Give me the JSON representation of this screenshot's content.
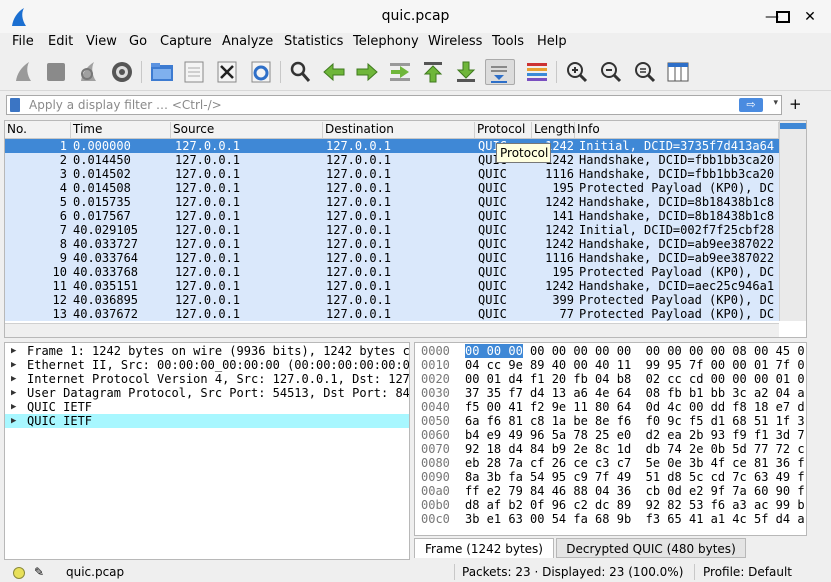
{
  "window": {
    "title": "quic.pcap",
    "min": "—",
    "max": "☐",
    "close": "✕"
  },
  "menu": [
    "File",
    "Edit",
    "View",
    "Go",
    "Capture",
    "Analyze",
    "Statistics",
    "Telephony",
    "Wireless",
    "Tools",
    "Help"
  ],
  "toolbar_icons": [
    "start-capture-icon",
    "stop-capture-icon",
    "restart-capture-icon",
    "capture-options-icon",
    "open-file-icon",
    "save-file-icon",
    "close-file-icon",
    "reload-file-icon",
    "find-packet-icon",
    "go-back-icon",
    "go-forward-icon",
    "go-to-packet-icon",
    "first-packet-icon",
    "last-packet-icon",
    "autoscroll-icon",
    "colorize-icon",
    "zoom-in-icon",
    "zoom-out-icon",
    "normal-size-icon",
    "resize-columns-icon"
  ],
  "filter": {
    "placeholder": "Apply a display filter … <Ctrl-/>",
    "apply": "⇨",
    "dropdown": "▾",
    "add": "+"
  },
  "columns": [
    "No.",
    "Time",
    "Source",
    "Destination",
    "Protocol",
    "Length",
    "Info"
  ],
  "packets": [
    {
      "no": "1",
      "time": "0.000000",
      "src": "127.0.0.1",
      "dst": "127.0.0.1",
      "proto": "QUIC",
      "len": "1242",
      "info": "Initial, DCID=3735f7d413a64"
    },
    {
      "no": "2",
      "time": "0.014450",
      "src": "127.0.0.1",
      "dst": "127.0.0.1",
      "proto": "QUIC",
      "len": "1242",
      "info": "Handshake, DCID=fbb1bb3ca20"
    },
    {
      "no": "3",
      "time": "0.014502",
      "src": "127.0.0.1",
      "dst": "127.0.0.1",
      "proto": "QUIC",
      "len": "1116",
      "info": "Handshake, DCID=fbb1bb3ca20"
    },
    {
      "no": "4",
      "time": "0.014508",
      "src": "127.0.0.1",
      "dst": "127.0.0.1",
      "proto": "QUIC",
      "len": "195",
      "info": "Protected Payload (KP0), DC"
    },
    {
      "no": "5",
      "time": "0.015735",
      "src": "127.0.0.1",
      "dst": "127.0.0.1",
      "proto": "QUIC",
      "len": "1242",
      "info": "Handshake, DCID=8b18438b1c8"
    },
    {
      "no": "6",
      "time": "0.017567",
      "src": "127.0.0.1",
      "dst": "127.0.0.1",
      "proto": "QUIC",
      "len": "141",
      "info": "Handshake, DCID=8b18438b1c8"
    },
    {
      "no": "7",
      "time": "40.029105",
      "src": "127.0.0.1",
      "dst": "127.0.0.1",
      "proto": "QUIC",
      "len": "1242",
      "info": "Initial, DCID=002f7f25cbf28"
    },
    {
      "no": "8",
      "time": "40.033727",
      "src": "127.0.0.1",
      "dst": "127.0.0.1",
      "proto": "QUIC",
      "len": "1242",
      "info": "Handshake, DCID=ab9ee387022"
    },
    {
      "no": "9",
      "time": "40.033764",
      "src": "127.0.0.1",
      "dst": "127.0.0.1",
      "proto": "QUIC",
      "len": "1116",
      "info": "Handshake, DCID=ab9ee387022"
    },
    {
      "no": "10",
      "time": "40.033768",
      "src": "127.0.0.1",
      "dst": "127.0.0.1",
      "proto": "QUIC",
      "len": "195",
      "info": "Protected Payload (KP0), DC"
    },
    {
      "no": "11",
      "time": "40.035151",
      "src": "127.0.0.1",
      "dst": "127.0.0.1",
      "proto": "QUIC",
      "len": "1242",
      "info": "Handshake, DCID=aec25c946a1"
    },
    {
      "no": "12",
      "time": "40.036895",
      "src": "127.0.0.1",
      "dst": "127.0.0.1",
      "proto": "QUIC",
      "len": "399",
      "info": "Protected Payload (KP0), DC"
    },
    {
      "no": "13",
      "time": "40.037672",
      "src": "127.0.0.1",
      "dst": "127.0.0.1",
      "proto": "QUIC",
      "len": "77",
      "info": "Protected Payload (KP0), DC"
    }
  ],
  "tooltip": "Protocol",
  "details": [
    "Frame 1: 1242 bytes on wire (9936 bits), 1242 bytes c",
    "Ethernet II, Src: 00:00:00_00:00:00 (00:00:00:00:00:0",
    "Internet Protocol Version 4, Src: 127.0.0.1, Dst: 127",
    "User Datagram Protocol, Src Port: 54513, Dst Port: 84",
    "QUIC IETF",
    "QUIC IETF"
  ],
  "hex": [
    {
      "off": "0000",
      "first": "00 00 00",
      "rest": " 00 00 00 00 00  00 00 00 00 08 00 45 0"
    },
    {
      "off": "0010",
      "first": "",
      "rest": "04 cc 9e 89 40 00 40 11  99 95 7f 00 00 01 7f 0"
    },
    {
      "off": "0020",
      "first": "",
      "rest": "00 01 d4 f1 20 fb 04 b8  02 cc cd 00 00 00 01 0"
    },
    {
      "off": "0030",
      "first": "",
      "rest": "37 35 f7 d4 13 a6 4e 64  08 fb b1 bb 3c a2 04 a"
    },
    {
      "off": "0040",
      "first": "",
      "rest": "f5 00 41 f2 9e 11 80 64  0d 4c 00 dd f8 18 e7 d"
    },
    {
      "off": "0050",
      "first": "",
      "rest": "6a f6 81 c8 1a be 8e f6  f0 9c f5 d1 68 51 1f 3"
    },
    {
      "off": "0060",
      "first": "",
      "rest": "b4 e9 49 96 5a 78 25 e0  d2 ea 2b 93 f9 f1 3d 7"
    },
    {
      "off": "0070",
      "first": "",
      "rest": "92 18 d4 84 b9 2e 8c 1d  db 74 2e 0b 5d 77 72 c"
    },
    {
      "off": "0080",
      "first": "",
      "rest": "eb 28 7a cf 26 ce c3 c7  5e 0e 3b 4f ce 81 36 f"
    },
    {
      "off": "0090",
      "first": "",
      "rest": "8a 3b fa 54 95 c9 7f 49  51 d8 5c cd 7c 63 49 f"
    },
    {
      "off": "00a0",
      "first": "",
      "rest": "ff e2 79 84 46 88 04 36  cb 0d e2 9f 7a 60 90 f"
    },
    {
      "off": "00b0",
      "first": "",
      "rest": "d8 af b2 0f 96 c2 dc 89  92 82 53 f6 a3 ac 99 b"
    },
    {
      "off": "00c0",
      "first": "",
      "rest": "3b e1 63 00 54 fa 68 9b  f3 65 41 a1 4c 5f d4 a"
    }
  ],
  "tabs": [
    "Frame (1242 bytes)",
    "Decrypted QUIC (480 bytes)"
  ],
  "status": {
    "file": "quic.pcap",
    "packets": "Packets: 23 · Displayed: 23 (100.0%)",
    "profile": "Profile: Default"
  },
  "colors": {
    "selected": "#3f88d6",
    "row_bg": "#dae8fb",
    "highlight": "#a8f7ff"
  }
}
